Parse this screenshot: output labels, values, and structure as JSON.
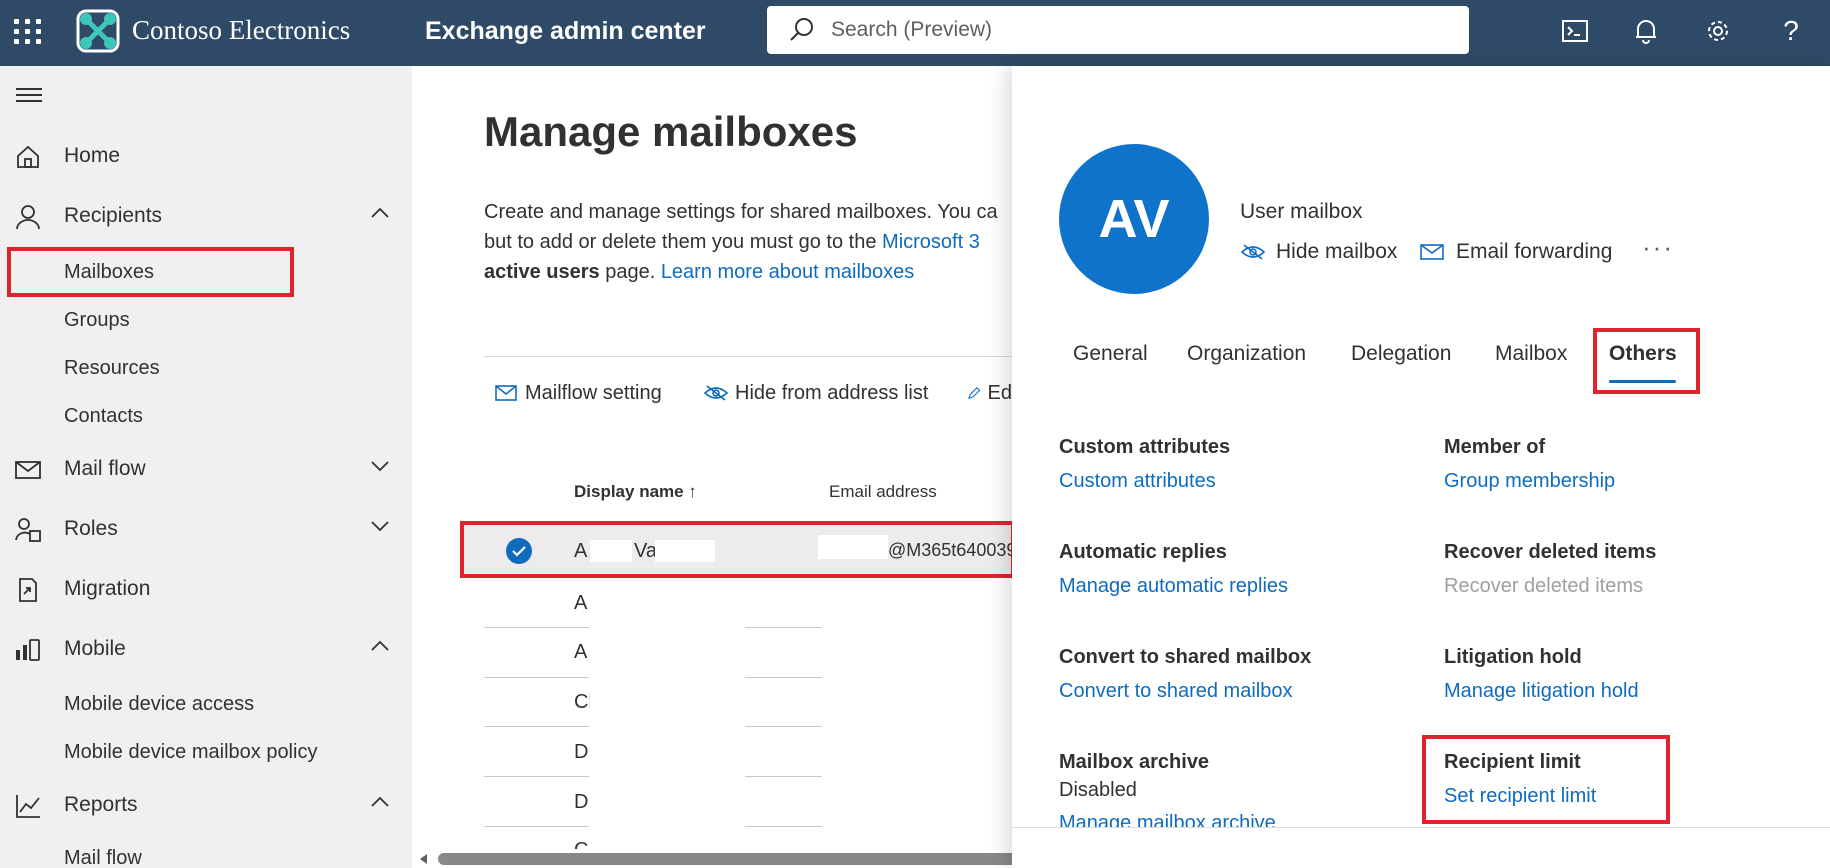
{
  "header": {
    "brand": "Contoso Electronics",
    "app_title": "Exchange admin center",
    "search_placeholder": "Search (Preview)"
  },
  "nav": {
    "items": [
      {
        "label": "Home",
        "icon": "home-icon"
      },
      {
        "label": "Recipients",
        "icon": "person-icon",
        "expanded": true
      },
      {
        "label": "Mail flow",
        "icon": "mail-icon",
        "expanded": false
      },
      {
        "label": "Roles",
        "icon": "roles-icon",
        "expanded": false
      },
      {
        "label": "Migration",
        "icon": "migration-icon"
      },
      {
        "label": "Mobile",
        "icon": "mobile-icon",
        "expanded": true
      },
      {
        "label": "Reports",
        "icon": "chart-icon",
        "expanded": true
      }
    ],
    "recipients_sub": [
      "Mailboxes",
      "Groups",
      "Resources",
      "Contacts"
    ],
    "mobile_sub": [
      "Mobile device access",
      "Mobile device mailbox policy"
    ],
    "reports_sub": [
      "Mail flow"
    ]
  },
  "main": {
    "title": "Manage mailboxes",
    "desc_line1": "Create and manage settings for shared mailboxes. You ca",
    "desc_line2_a": "but to add or delete them you must go to the ",
    "desc_line2_link": "Microsoft 3",
    "desc_line3_bold": "active users",
    "desc_line3_rest": " page. ",
    "desc_line3_link": "Learn more about mailboxes",
    "commands": [
      "Mailflow setting",
      "Hide from address list",
      "Ed"
    ],
    "columns": [
      "Display name",
      "Email address"
    ],
    "selected_row": {
      "name_a": "A",
      "name_b": "Va",
      "email": "@M365t640039"
    },
    "rows": [
      "A",
      "A",
      "Cl",
      "D",
      "D",
      "C"
    ]
  },
  "panel": {
    "initials": "AV",
    "mailbox_type": "User mailbox",
    "actions": [
      "Hide mailbox",
      "Email forwarding"
    ],
    "more": "···",
    "tabs": [
      "General",
      "Organization",
      "Delegation",
      "Mailbox",
      "Others"
    ],
    "active_tab": "Others",
    "sections": [
      {
        "heading": "Custom attributes",
        "link": "Custom attributes"
      },
      {
        "heading": "Member of",
        "link": "Group membership"
      },
      {
        "heading": "Automatic replies",
        "link": "Manage automatic replies"
      },
      {
        "heading": "Recover deleted items",
        "link": "Recover deleted items"
      },
      {
        "heading": "Convert to shared mailbox",
        "link": "Convert to shared mailbox"
      },
      {
        "heading": "Litigation hold",
        "link": "Manage litigation hold"
      },
      {
        "heading": "Mailbox archive",
        "text": "Disabled",
        "link": "Manage mailbox archive"
      },
      {
        "heading": "Recipient limit",
        "link": "Set recipient limit"
      }
    ]
  },
  "colors": {
    "topbar": "#2f4a66",
    "accent": "#0f6cbd",
    "highlight": "#e12330"
  }
}
